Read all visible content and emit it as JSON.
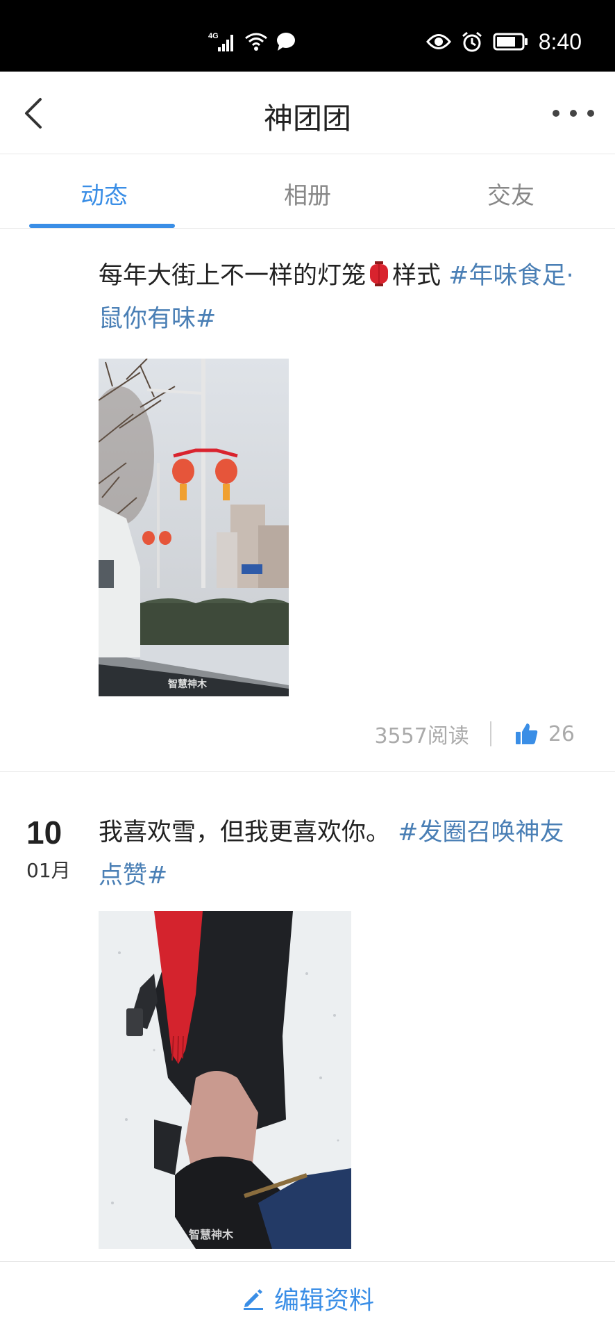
{
  "status_bar": {
    "network": "4G",
    "time": "8:40",
    "icons": [
      "signal-icon",
      "wifi-icon",
      "message-icon",
      "eye-icon",
      "alarm-icon",
      "battery-icon"
    ]
  },
  "nav": {
    "title": "神团团",
    "back_icon": "chevron-left-icon",
    "more_icon": "more-dots-icon"
  },
  "tabs": [
    {
      "label": "动态",
      "active": true
    },
    {
      "label": "相册",
      "active": false
    },
    {
      "label": "交友",
      "active": false
    }
  ],
  "posts": [
    {
      "day": "",
      "month": "",
      "text_before": "每年大街上不一样的灯笼",
      "text_after": "样式",
      "hashtag": "#年味食足·鼠你有味#",
      "image_watermark": "智慧神木",
      "reads": "3557阅读",
      "likes": "26"
    },
    {
      "day": "10",
      "month": "01月",
      "text_before": "我喜欢雪，但我更喜欢你。",
      "text_after": "",
      "hashtag": "#发圈召唤神友点赞#",
      "image_watermark": "智慧神木"
    }
  ],
  "bottom_bar": {
    "edit_label": "编辑资料",
    "edit_icon": "pencil-icon"
  },
  "colors": {
    "accent": "#3a8ee6",
    "hashtag": "#4a7fb5",
    "muted": "#aaaaaa"
  }
}
